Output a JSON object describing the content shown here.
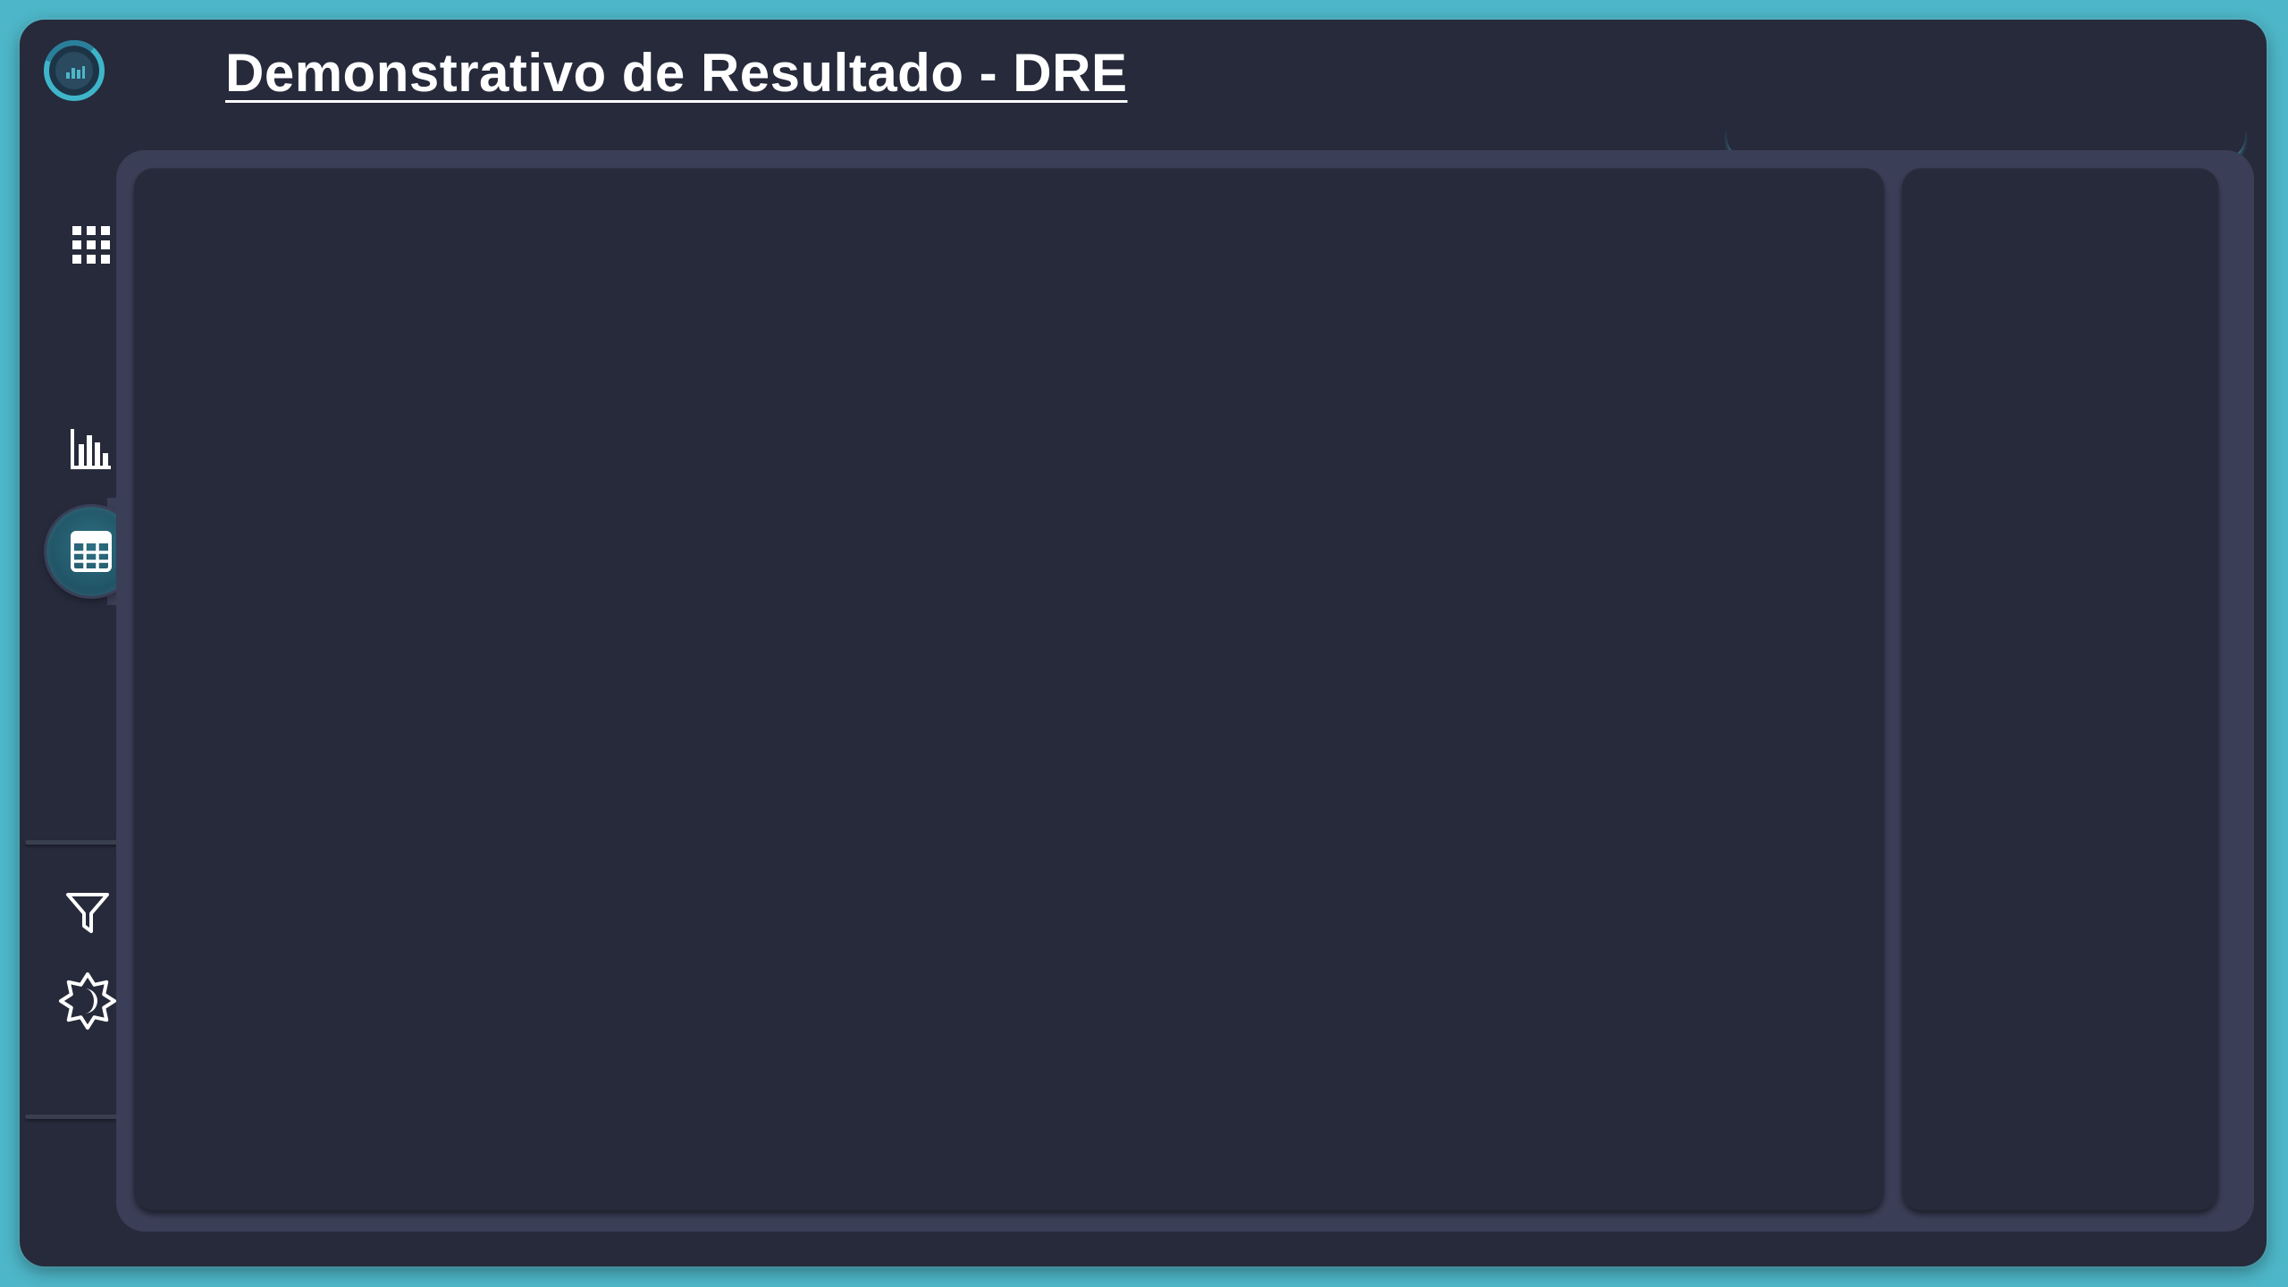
{
  "header": {
    "title": "Demonstrativo de Resultado - DRE"
  },
  "sidebar": {
    "items": [
      {
        "id": "apps",
        "icon": "apps-grid-icon",
        "active": false
      },
      {
        "id": "chart",
        "icon": "bar-chart-icon",
        "active": false
      },
      {
        "id": "table",
        "icon": "table-calculator-icon",
        "active": true
      },
      {
        "id": "filter",
        "icon": "filter-icon",
        "active": false
      },
      {
        "id": "theme",
        "icon": "theme-toggle-icon",
        "active": false
      }
    ]
  },
  "colors": {
    "page_background": "#4db6c8",
    "app_background": "#262a3b",
    "frame_background": "#3a3e56",
    "accent": "#4db6c8",
    "active_item": "#1f5264",
    "text": "#ffffff"
  }
}
